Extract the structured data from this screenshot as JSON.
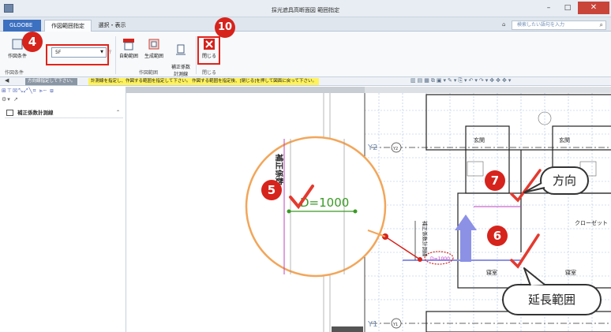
{
  "window": {
    "title": "採光遮具高断面図 範囲指定",
    "min": "–",
    "max": "□",
    "close": "✕"
  },
  "tabs": {
    "gloobe": "GLOOBE",
    "items": [
      "作図範囲指定",
      "選択・表示"
    ]
  },
  "search": {
    "placeholder": "検索したい語句を入力",
    "icon": "search-icon"
  },
  "ribbon": {
    "draw_condition_label": "作図条件",
    "floor_value": "5F",
    "buttons": [
      "自動範囲",
      "生成範囲",
      "補正係数\n計測線",
      "閉じる"
    ],
    "groups": [
      "作図条件",
      "作図範囲",
      "閉じる"
    ]
  },
  "prompt": {
    "tag": "方向線指定して下さい。",
    "text": "計測線を指定し、作図する範囲を指定して下さい。 作図する範囲を指定後、[閉じる]を押して図面に戻って下さい。"
  },
  "panel": {
    "header": "補正係数計測線"
  },
  "drawing": {
    "grid_y2": "Y2",
    "grid_y1": "Y1",
    "marker_y2": "Y2",
    "marker_y1": "Y1",
    "dimension_label": "D=1000",
    "small_dim_label": "D=1000",
    "vertical_label": "補正係数計測線",
    "zoom_vertical_label": "補正係数",
    "rooms": [
      "玄関",
      "玄関",
      "寝室",
      "寝室",
      "クローゼット"
    ]
  },
  "callouts": {
    "direction": "方向",
    "extension": "延長範囲"
  },
  "badges": [
    "4",
    "5",
    "6",
    "7",
    "10"
  ],
  "colors": {
    "accent_red": "#e2231a",
    "badge_red": "#d6231c",
    "zoom_orange": "#f2a65a",
    "arrow_blue": "#8c91e6",
    "check_red": "#e43a2f",
    "dim_green": "#3a9a24"
  }
}
